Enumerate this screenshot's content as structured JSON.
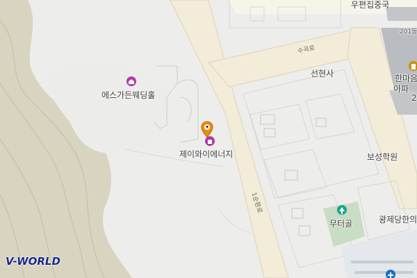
{
  "map": {
    "provider_logo": "V-WORLD",
    "colors": {
      "background": "#ededeb",
      "hill_base": "#d8d4c0",
      "hill_contour": "#c9c4a8",
      "road_fill": "#f3ecd9",
      "road_edge": "#dcd3b8",
      "block_outline": "#d9d9d9",
      "building": "#b9bcc0",
      "green": "#c9dcc4",
      "poi_purple": "#b23aa5",
      "poi_orange": "#f08c00",
      "poi_teal": "#1aa58a",
      "poi_gold": "#c89400"
    },
    "labels": {
      "post_office": "우편집중국",
      "building_201": "201동",
      "road_sugokro": "수곡로",
      "temple": "선현사",
      "apartment_name_1": "한마음",
      "apartment_name_2": "아파",
      "apartment_num": "2",
      "wedding_hall": "에스가든웨딩홀",
      "selected_poi": "제이와이에너지",
      "academy": "보성학원",
      "road_1sunhwan": "1순환로",
      "park": "무터골",
      "clinic": "광제당한의"
    },
    "icons": {
      "wedding_hall": "wedding-hall-icon",
      "selected_marker": "location-pin-icon",
      "selected_poi": "energy-company-icon",
      "park": "park-icon",
      "apartment": "apartment-icon",
      "clinic": "clinic-icon"
    }
  }
}
